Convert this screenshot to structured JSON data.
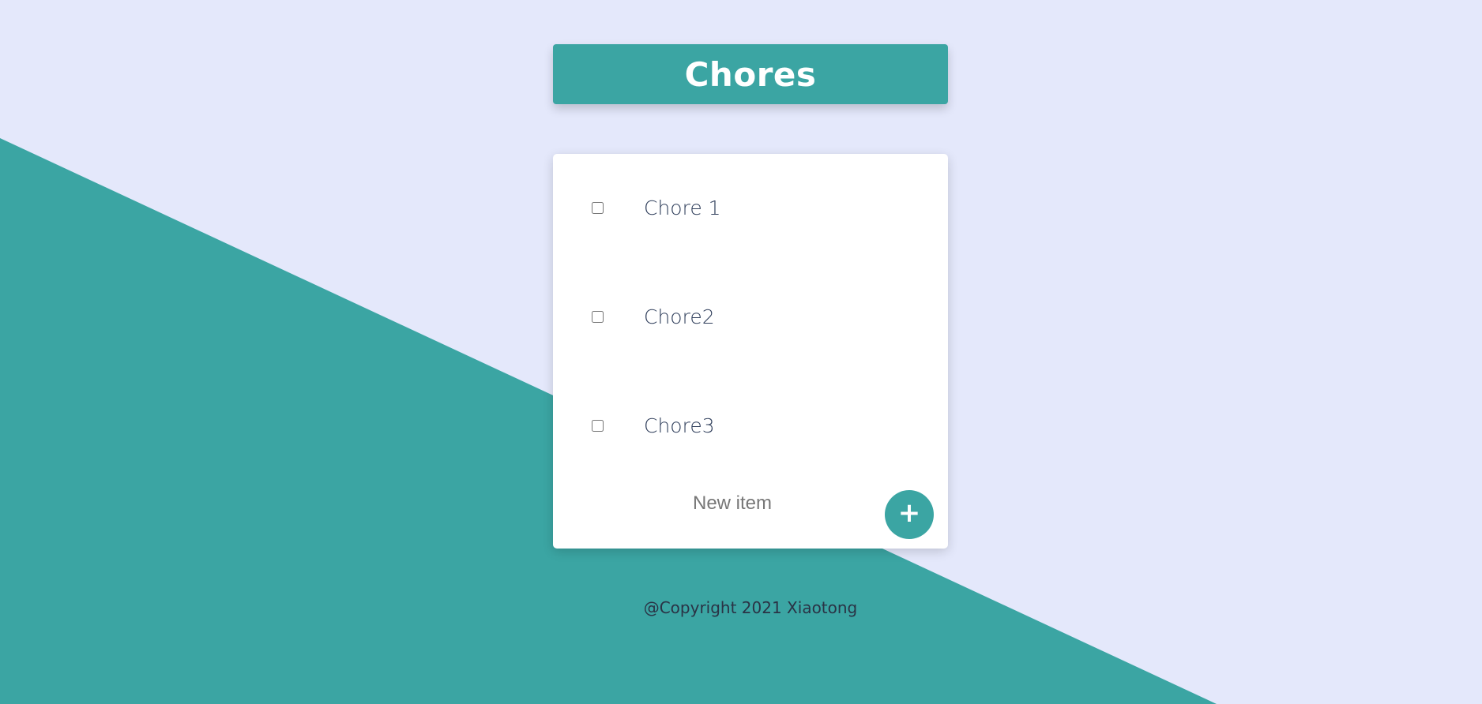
{
  "colors": {
    "accent": "#3ba5a3",
    "background": "#e4e8fb",
    "card": "#ffffff",
    "item_text": "#2f3e5b"
  },
  "header": {
    "title": "Chores"
  },
  "todo": {
    "items": [
      {
        "label": "Chore 1",
        "checked": false
      },
      {
        "label": "Chore2",
        "checked": false
      },
      {
        "label": "Chore3",
        "checked": false
      }
    ],
    "new_item": {
      "placeholder": "New item",
      "value": ""
    },
    "add_button": {
      "label": "+",
      "icon": "plus-icon"
    }
  },
  "footer": {
    "text": "@Copyright 2021 Xiaotong"
  }
}
